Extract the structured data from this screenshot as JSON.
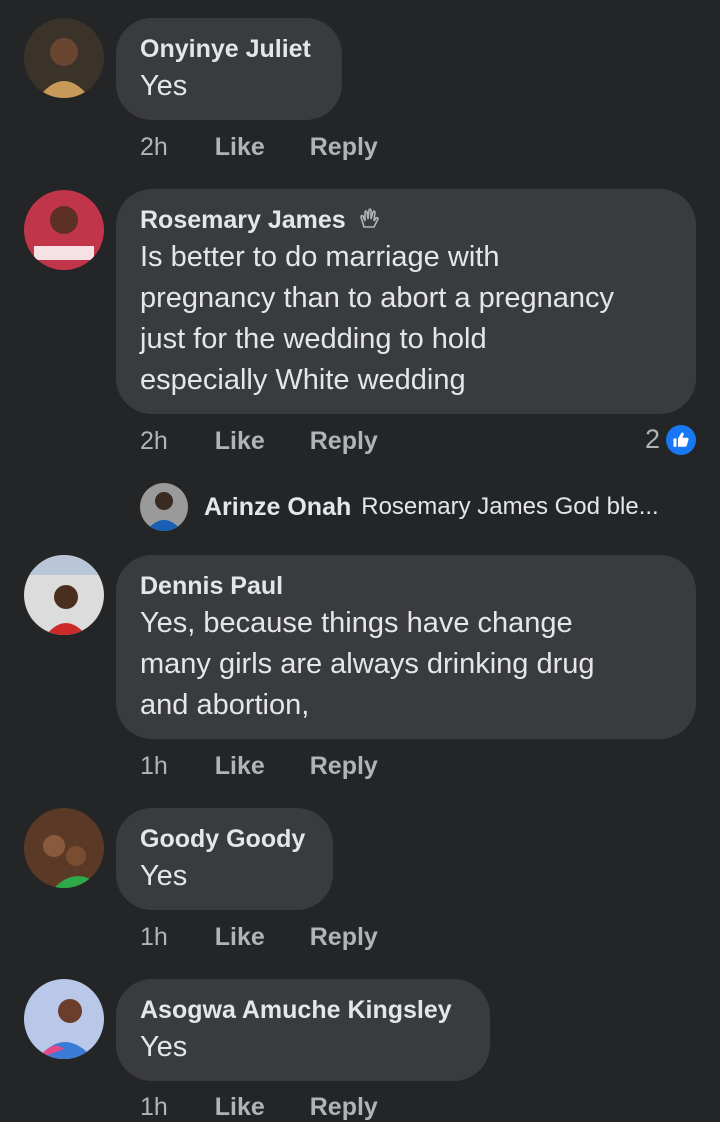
{
  "comments": [
    {
      "author": "Onyinye Juliet",
      "text": [
        "Yes"
      ],
      "time": "2h",
      "like": "Like",
      "reply": "Reply"
    },
    {
      "author": "Rosemary James",
      "text": [
        "Is better to do marriage with",
        "pregnancy than to abort a pregnancy",
        "just for the wedding to hold",
        "especially White wedding"
      ],
      "time": "2h",
      "like": "Like",
      "reply": "Reply",
      "reaction_count": "2",
      "reply_preview": {
        "author": "Arinze Onah",
        "text": "Rosemary James God ble..."
      }
    },
    {
      "author": "Dennis Paul",
      "text": [
        "Yes, because things have change",
        "many girls are always drinking drug",
        "and abortion,"
      ],
      "time": "1h",
      "like": "Like",
      "reply": "Reply"
    },
    {
      "author": "Goody Goody",
      "text": [
        "Yes"
      ],
      "time": "1h",
      "like": "Like",
      "reply": "Reply"
    },
    {
      "author": "Asogwa Amuche Kingsley",
      "text": [
        "Yes"
      ],
      "time": "1h",
      "like": "Like",
      "reply": "Reply"
    }
  ],
  "colors": {
    "background": "#242526",
    "bubble": "#3a3b3c",
    "text": "#e4e6eb",
    "muted": "#b0b3b8",
    "like_blue": "#1877f2"
  }
}
